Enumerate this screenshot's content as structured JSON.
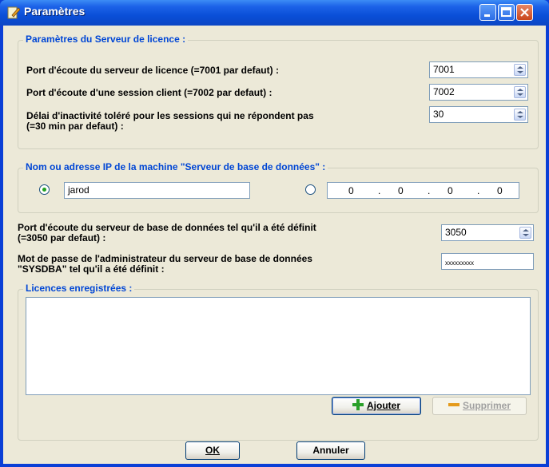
{
  "window": {
    "title": "Paramètres"
  },
  "license_server": {
    "legend": "Paramètres du Serveur de licence :",
    "listen_port_label": "Port d'écoute du serveur de licence (=7001 par defaut) :",
    "listen_port_value": "7001",
    "client_port_label": "Port d'écoute d'une session client    (=7002 par defaut) :",
    "client_port_value": "7002",
    "timeout_label_line1": "Délai d'inactivité toléré pour les sessions qui ne répondent pas",
    "timeout_label_line2": "(=30 min par defaut) :",
    "timeout_value": "30"
  },
  "db_host": {
    "legend": "Nom ou adresse IP de la machine \"Serveur de base de données\" :",
    "name_value": "jarod",
    "ip": [
      "0",
      "0",
      "0",
      "0"
    ],
    "ip_separator": ".",
    "selected": "name"
  },
  "db_port": {
    "label_line1": "Port d'écoute du serveur de base de données tel qu'il a été définit",
    "label_line2": "(=3050 par defaut) :",
    "value": "3050"
  },
  "db_password": {
    "label_line1": "Mot de passe de l'administrateur du serveur de base de données",
    "label_line2": "\"SYSDBA\" tel qu'il a été définit :",
    "value": "xxxxxxxxx"
  },
  "licenses": {
    "legend": "Licences enregistrées :",
    "add_label": "Ajouter",
    "remove_label": "Supprimer"
  },
  "footer": {
    "ok_label": "OK",
    "cancel_label": "Annuler"
  }
}
